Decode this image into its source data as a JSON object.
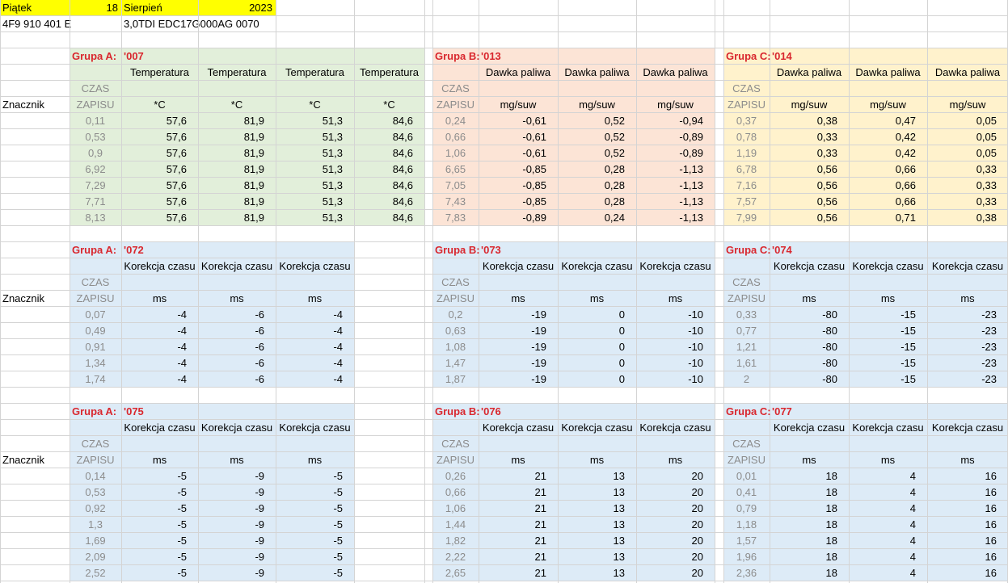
{
  "colors": {
    "grid": "#d4d4d4",
    "highlight_yellow": "#ffff00",
    "panel_green": "#e2efda",
    "panel_salmon": "#fce4d6",
    "panel_cream": "#fff2cc",
    "panel_blue": "#ddebf7",
    "group_label_red": "#d9272e",
    "time_gray": "#8c8c8c"
  },
  "header": {
    "day": "Piątek",
    "date_num": "18",
    "month": "Sierpień",
    "year": "2023",
    "part_number": "4F9 910 401 E",
    "ecu": "3,0TDI EDC17G000AG  0070"
  },
  "labels": {
    "marker": "Znacznik",
    "czas": "CZAS",
    "zapisu": "ZAPISU"
  },
  "blocks": [
    {
      "id": "block-007",
      "col": 0,
      "row": 0,
      "bg": "#e2efda",
      "group": "Grupa A:",
      "code": "'007",
      "headers": [
        "Temperatura",
        "Temperatura",
        "Temperatura",
        "Temperatura"
      ],
      "units": [
        "*C",
        "*C",
        "*C",
        "*C"
      ],
      "rows": [
        [
          "0,11",
          "57,6",
          "81,9",
          "51,3",
          "84,6"
        ],
        [
          "0,53",
          "57,6",
          "81,9",
          "51,3",
          "84,6"
        ],
        [
          "0,9",
          "57,6",
          "81,9",
          "51,3",
          "84,6"
        ],
        [
          "6,92",
          "57,6",
          "81,9",
          "51,3",
          "84,6"
        ],
        [
          "7,29",
          "57,6",
          "81,9",
          "51,3",
          "84,6"
        ],
        [
          "7,71",
          "57,6",
          "81,9",
          "51,3",
          "84,6"
        ],
        [
          "8,13",
          "57,6",
          "81,9",
          "51,3",
          "84,6"
        ]
      ]
    },
    {
      "id": "block-013",
      "col": 1,
      "row": 0,
      "bg": "#fce4d6",
      "group": "Grupa B:",
      "code": "'013",
      "headers": [
        "Dawka paliwa",
        "Dawka paliwa",
        "Dawka paliwa"
      ],
      "units": [
        "mg/suw",
        "mg/suw",
        "mg/suw"
      ],
      "rows": [
        [
          "0,24",
          "-0,61",
          "0,52",
          "-0,94"
        ],
        [
          "0,66",
          "-0,61",
          "0,52",
          "-0,89"
        ],
        [
          "1,06",
          "-0,61",
          "0,52",
          "-0,89"
        ],
        [
          "6,65",
          "-0,85",
          "0,28",
          "-1,13"
        ],
        [
          "7,05",
          "-0,85",
          "0,28",
          "-1,13"
        ],
        [
          "7,43",
          "-0,85",
          "0,28",
          "-1,13"
        ],
        [
          "7,83",
          "-0,89",
          "0,24",
          "-1,13"
        ]
      ]
    },
    {
      "id": "block-014",
      "col": 2,
      "row": 0,
      "bg": "#fff2cc",
      "group": "Grupa C:",
      "code": "'014",
      "headers": [
        "Dawka paliwa",
        "Dawka paliwa",
        "Dawka paliwa"
      ],
      "units": [
        "mg/suw",
        "mg/suw",
        "mg/suw"
      ],
      "rows": [
        [
          "0,37",
          "0,38",
          "0,47",
          "0,05"
        ],
        [
          "0,78",
          "0,33",
          "0,42",
          "0,05"
        ],
        [
          "1,19",
          "0,33",
          "0,42",
          "0,05"
        ],
        [
          "6,78",
          "0,56",
          "0,66",
          "0,33"
        ],
        [
          "7,16",
          "0,56",
          "0,66",
          "0,33"
        ],
        [
          "7,57",
          "0,56",
          "0,66",
          "0,33"
        ],
        [
          "7,99",
          "0,56",
          "0,71",
          "0,38"
        ]
      ]
    },
    {
      "id": "block-072",
      "col": 0,
      "row": 1,
      "bg": "#ddebf7",
      "group": "Grupa A:",
      "code": "'072",
      "headers": [
        "Korekcja czasu",
        "Korekcja czasu",
        "Korekcja czasu"
      ],
      "units": [
        "ms",
        "ms",
        "ms"
      ],
      "rows": [
        [
          "0,07",
          "-4",
          "-6",
          "-4"
        ],
        [
          "0,49",
          "-4",
          "-6",
          "-4"
        ],
        [
          "0,91",
          "-4",
          "-6",
          "-4"
        ],
        [
          "1,34",
          "-4",
          "-6",
          "-4"
        ],
        [
          "1,74",
          "-4",
          "-6",
          "-4"
        ]
      ]
    },
    {
      "id": "block-073",
      "col": 1,
      "row": 1,
      "bg": "#ddebf7",
      "group": "Grupa B:",
      "code": "'073",
      "headers": [
        "Korekcja czasu",
        "Korekcja czasu",
        "Korekcja czasu"
      ],
      "units": [
        "ms",
        "ms",
        "ms"
      ],
      "rows": [
        [
          "0,2",
          "-19",
          "0",
          "-10"
        ],
        [
          "0,63",
          "-19",
          "0",
          "-10"
        ],
        [
          "1,08",
          "-19",
          "0",
          "-10"
        ],
        [
          "1,47",
          "-19",
          "0",
          "-10"
        ],
        [
          "1,87",
          "-19",
          "0",
          "-10"
        ]
      ]
    },
    {
      "id": "block-074",
      "col": 2,
      "row": 1,
      "bg": "#ddebf7",
      "group": "Grupa C:",
      "code": "'074",
      "headers": [
        "Korekcja czasu",
        "Korekcja czasu",
        "Korekcja czasu"
      ],
      "units": [
        "ms",
        "ms",
        "ms"
      ],
      "rows": [
        [
          "0,33",
          "-80",
          "-15",
          "-23"
        ],
        [
          "0,77",
          "-80",
          "-15",
          "-23"
        ],
        [
          "1,21",
          "-80",
          "-15",
          "-23"
        ],
        [
          "1,61",
          "-80",
          "-15",
          "-23"
        ],
        [
          "2",
          "-80",
          "-15",
          "-23"
        ]
      ]
    },
    {
      "id": "block-075",
      "col": 0,
      "row": 2,
      "bg": "#ddebf7",
      "group": "Grupa A:",
      "code": "'075",
      "headers": [
        "Korekcja czasu",
        "Korekcja czasu",
        "Korekcja czasu"
      ],
      "units": [
        "ms",
        "ms",
        "ms"
      ],
      "rows": [
        [
          "0,14",
          "-5",
          "-9",
          "-5"
        ],
        [
          "0,53",
          "-5",
          "-9",
          "-5"
        ],
        [
          "0,92",
          "-5",
          "-9",
          "-5"
        ],
        [
          "1,3",
          "-5",
          "-9",
          "-5"
        ],
        [
          "1,69",
          "-5",
          "-9",
          "-5"
        ],
        [
          "2,09",
          "-5",
          "-9",
          "-5"
        ],
        [
          "2,52",
          "-5",
          "-9",
          "-5"
        ]
      ]
    },
    {
      "id": "block-076",
      "col": 1,
      "row": 2,
      "bg": "#ddebf7",
      "group": "Grupa B:",
      "code": "'076",
      "headers": [
        "Korekcja czasu",
        "Korekcja czasu",
        "Korekcja czasu"
      ],
      "units": [
        "ms",
        "ms",
        "ms"
      ],
      "rows": [
        [
          "0,26",
          "21",
          "13",
          "20"
        ],
        [
          "0,66",
          "21",
          "13",
          "20"
        ],
        [
          "1,06",
          "21",
          "13",
          "20"
        ],
        [
          "1,44",
          "21",
          "13",
          "20"
        ],
        [
          "1,82",
          "21",
          "13",
          "20"
        ],
        [
          "2,22",
          "21",
          "13",
          "20"
        ],
        [
          "2,65",
          "21",
          "13",
          "20"
        ]
      ]
    },
    {
      "id": "block-077",
      "col": 2,
      "row": 2,
      "bg": "#ddebf7",
      "group": "Grupa C:",
      "code": "'077",
      "headers": [
        "Korekcja czasu",
        "Korekcja czasu",
        "Korekcja czasu"
      ],
      "units": [
        "ms",
        "ms",
        "ms"
      ],
      "rows": [
        [
          "0,01",
          "18",
          "4",
          "16"
        ],
        [
          "0,41",
          "18",
          "4",
          "16"
        ],
        [
          "0,79",
          "18",
          "4",
          "16"
        ],
        [
          "1,18",
          "18",
          "4",
          "16"
        ],
        [
          "1,57",
          "18",
          "4",
          "16"
        ],
        [
          "1,96",
          "18",
          "4",
          "16"
        ],
        [
          "2,36",
          "18",
          "4",
          "16"
        ]
      ]
    }
  ]
}
